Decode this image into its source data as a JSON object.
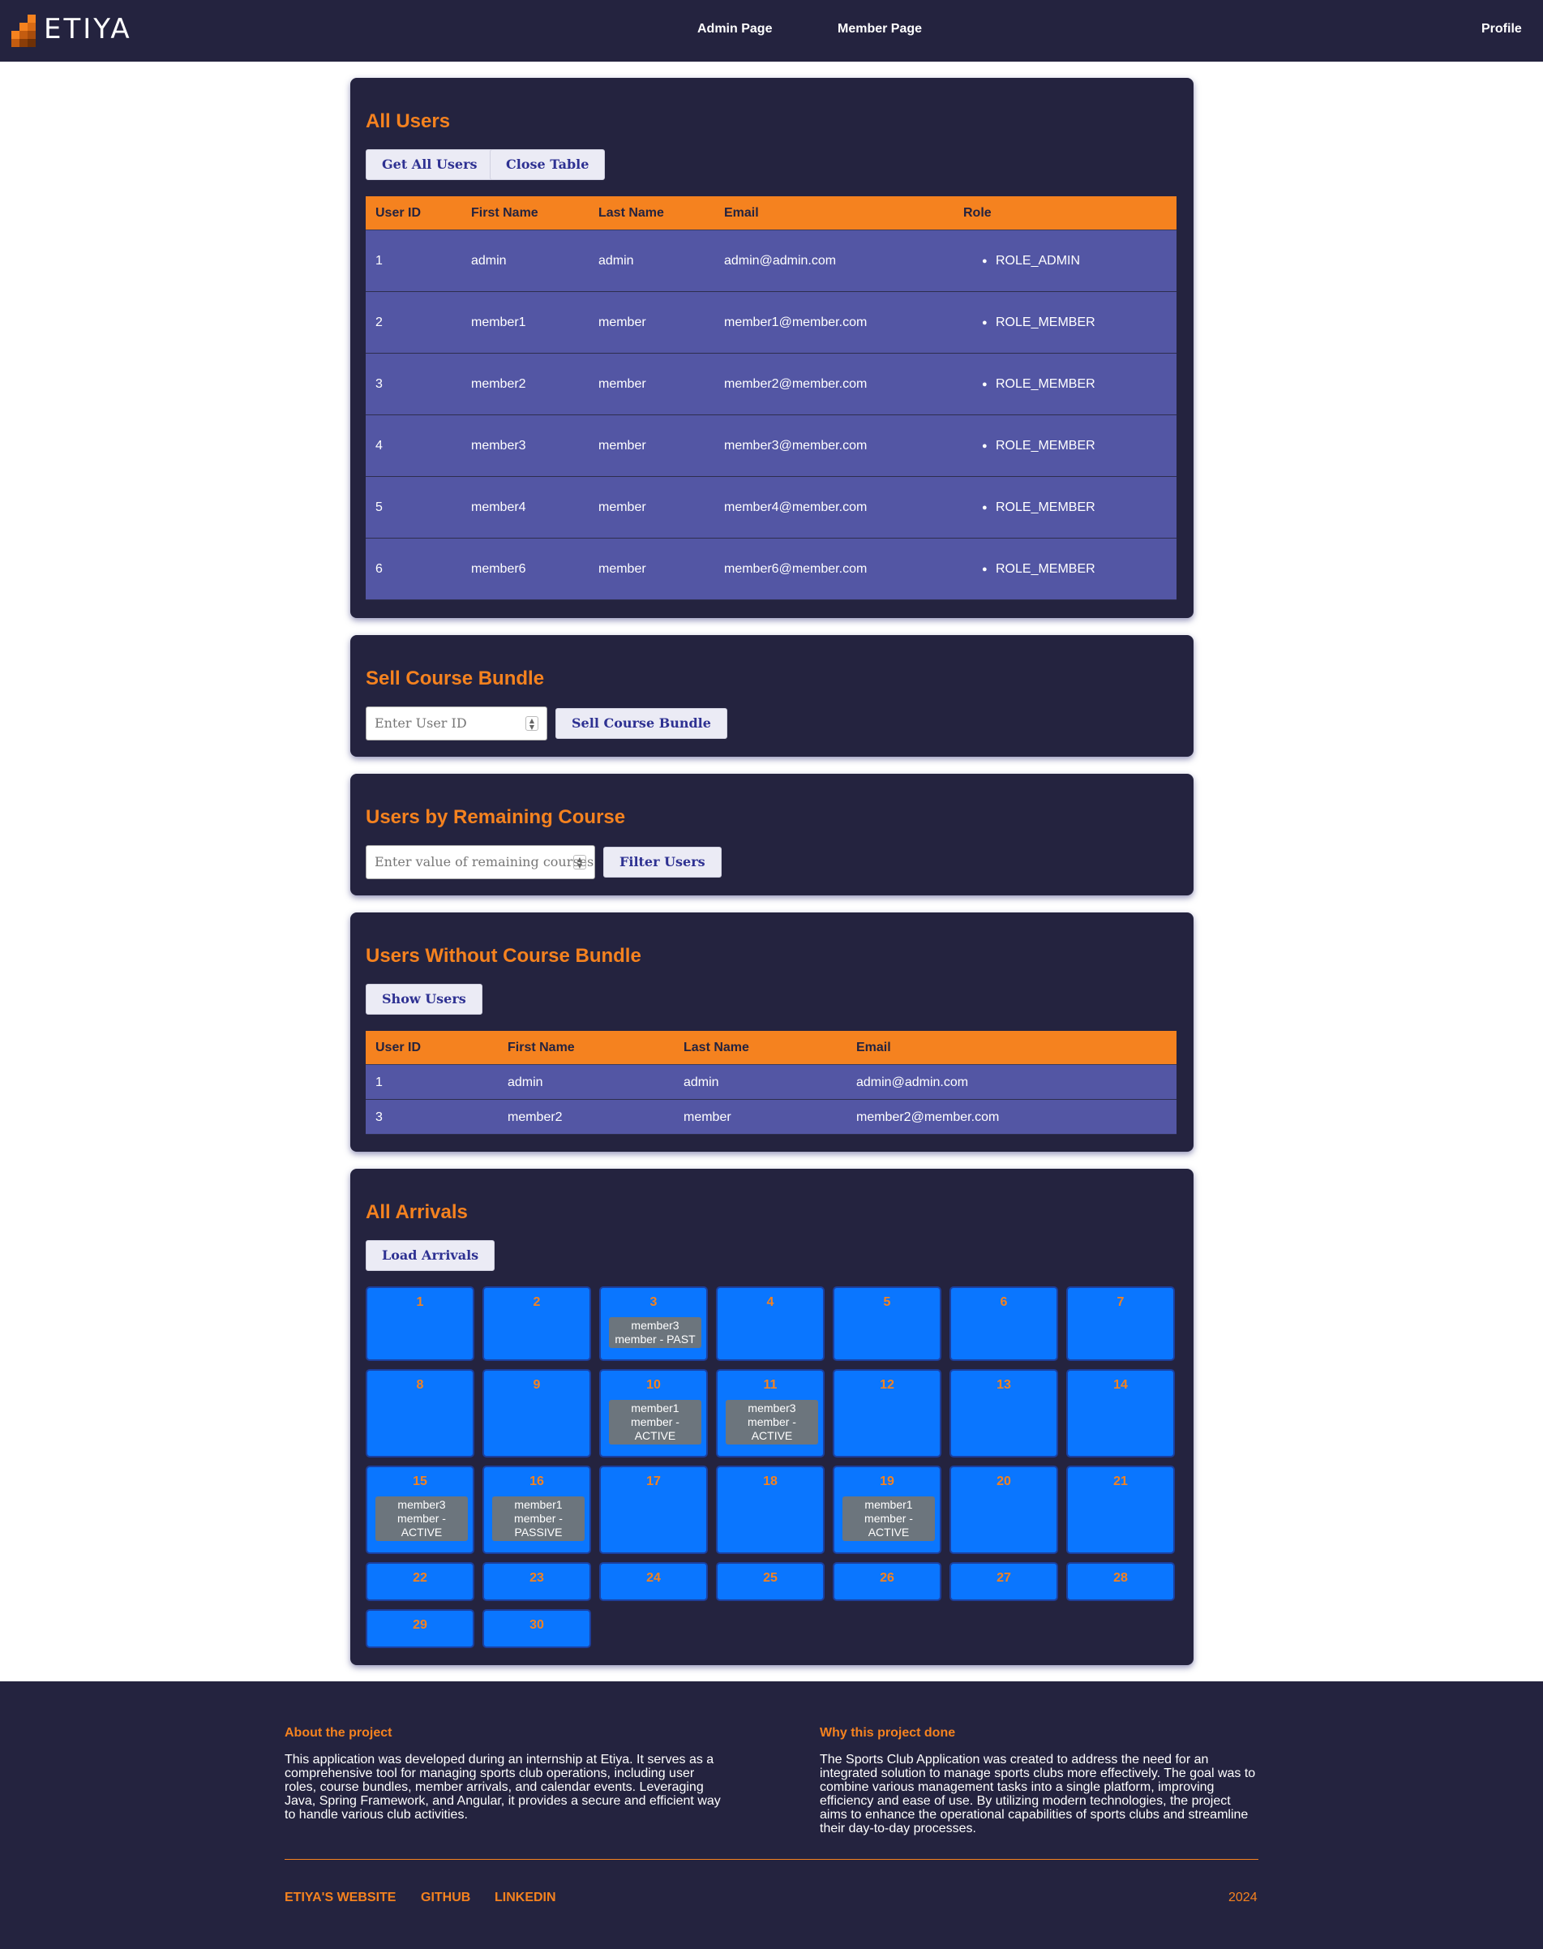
{
  "nav": {
    "brand": "ETIYA",
    "admin_link": "Admin Page",
    "member_link": "Member Page",
    "profile_link": "Profile"
  },
  "all_users": {
    "title": "All Users",
    "get_button": "Get All Users",
    "close_button": "Close Table",
    "columns": [
      "User ID",
      "First Name",
      "Last Name",
      "Email",
      "Role"
    ],
    "rows": [
      {
        "id": "1",
        "first": "admin",
        "last": "admin",
        "email": "admin@admin.com",
        "role": "ROLE_ADMIN"
      },
      {
        "id": "2",
        "first": "member1",
        "last": "member",
        "email": "member1@member.com",
        "role": "ROLE_MEMBER"
      },
      {
        "id": "3",
        "first": "member2",
        "last": "member",
        "email": "member2@member.com",
        "role": "ROLE_MEMBER"
      },
      {
        "id": "4",
        "first": "member3",
        "last": "member",
        "email": "member3@member.com",
        "role": "ROLE_MEMBER"
      },
      {
        "id": "5",
        "first": "member4",
        "last": "member",
        "email": "member4@member.com",
        "role": "ROLE_MEMBER"
      },
      {
        "id": "6",
        "first": "member6",
        "last": "member",
        "email": "member6@member.com",
        "role": "ROLE_MEMBER"
      }
    ]
  },
  "sell_bundle": {
    "title": "Sell Course Bundle",
    "input_placeholder": "Enter User ID",
    "button": "Sell Course Bundle"
  },
  "remaining": {
    "title": "Users by Remaining Course",
    "input_placeholder": "Enter value of remaining courses",
    "button": "Filter Users"
  },
  "without_bundle": {
    "title": "Users Without Course Bundle",
    "button": "Show Users",
    "columns": [
      "User ID",
      "First Name",
      "Last Name",
      "Email"
    ],
    "rows": [
      {
        "id": "1",
        "first": "admin",
        "last": "admin",
        "email": "admin@admin.com"
      },
      {
        "id": "3",
        "first": "member2",
        "last": "member",
        "email": "member2@member.com"
      }
    ]
  },
  "arrivals": {
    "title": "All Arrivals",
    "button": "Load Arrivals",
    "days": [
      {
        "day": "1",
        "events": []
      },
      {
        "day": "2",
        "events": []
      },
      {
        "day": "3",
        "events": [
          {
            "line1": "member3",
            "line2": "member - PAST"
          }
        ]
      },
      {
        "day": "4",
        "events": []
      },
      {
        "day": "5",
        "events": []
      },
      {
        "day": "6",
        "events": []
      },
      {
        "day": "7",
        "events": []
      },
      {
        "day": "8",
        "events": []
      },
      {
        "day": "9",
        "events": []
      },
      {
        "day": "10",
        "events": [
          {
            "line1": "member1",
            "line2": "member -",
            "line3": "ACTIVE"
          }
        ]
      },
      {
        "day": "11",
        "events": [
          {
            "line1": "member3",
            "line2": "member -",
            "line3": "ACTIVE"
          }
        ]
      },
      {
        "day": "12",
        "events": []
      },
      {
        "day": "13",
        "events": []
      },
      {
        "day": "14",
        "events": []
      },
      {
        "day": "15",
        "events": [
          {
            "line1": "member3",
            "line2": "member -",
            "line3": "ACTIVE"
          }
        ]
      },
      {
        "day": "16",
        "events": [
          {
            "line1": "member1",
            "line2": "member -",
            "line3": "PASSIVE"
          }
        ]
      },
      {
        "day": "17",
        "events": []
      },
      {
        "day": "18",
        "events": []
      },
      {
        "day": "19",
        "events": [
          {
            "line1": "member1",
            "line2": "member -",
            "line3": "ACTIVE"
          }
        ]
      },
      {
        "day": "20",
        "events": []
      },
      {
        "day": "21",
        "events": []
      },
      {
        "day": "22",
        "events": []
      },
      {
        "day": "23",
        "events": []
      },
      {
        "day": "24",
        "events": []
      },
      {
        "day": "25",
        "events": []
      },
      {
        "day": "26",
        "events": []
      },
      {
        "day": "27",
        "events": []
      },
      {
        "day": "28",
        "events": []
      },
      {
        "day": "29",
        "events": []
      },
      {
        "day": "30",
        "events": []
      }
    ]
  },
  "footer": {
    "about_title": "About the project",
    "about_lines": [
      "This application was developed during an internship at Etiya. It serves as a",
      "comprehensive tool for managing sports club operations, including user",
      "roles, course bundles, member arrivals, and calendar events. Leveraging",
      "Java, Spring Framework, and Angular, it provides a secure and efficient way",
      "to handle various club activities."
    ],
    "why_title": "Why this project done",
    "why_lines": [
      "The Sports Club Application was created to address the need for an",
      "integrated solution to manage sports clubs more effectively. The goal was to",
      "combine various management tasks into a single platform, improving",
      "efficiency and ease of use. By utilizing modern technologies, the project",
      "aims to enhance the operational capabilities of sports clubs and streamline",
      "their day-to-day processes."
    ],
    "links": [
      "ETIYA'S WEBSITE",
      "GITHUB",
      "LINKEDIN"
    ],
    "year": "2024"
  },
  "colors": {
    "navy": "#24233f",
    "orange": "#f5821f",
    "row_purple": "#5356a4",
    "calendar_blue": "#0a76ff",
    "event_gray": "#6c757d"
  }
}
